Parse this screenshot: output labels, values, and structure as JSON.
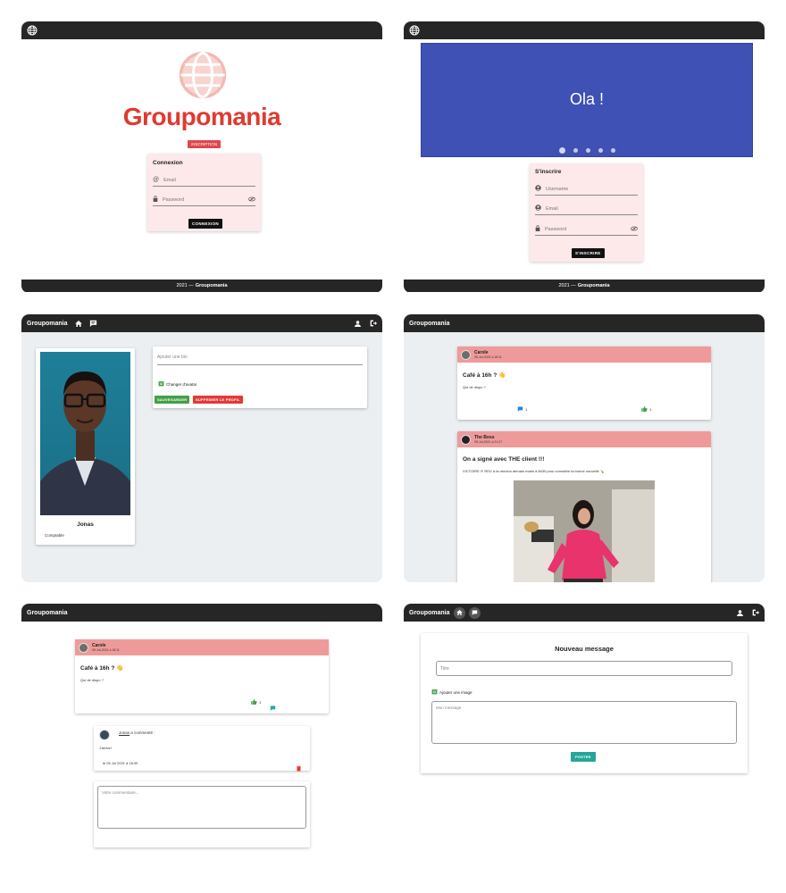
{
  "colors": {
    "bar": "#262626",
    "brand_red": "#e03a2f",
    "pink_light": "#fde9ea",
    "post_header": "#ef9a9a",
    "carousel_blue": "#3f51b5",
    "green": "#43a047",
    "red": "#e53935",
    "teal": "#26a69a"
  },
  "icons": [
    "globe-icon",
    "home-icon",
    "message-icon",
    "account-icon",
    "logout-icon",
    "at-icon",
    "lock-icon",
    "eye-off-icon",
    "user-icon",
    "comment-icon",
    "thumb-up-icon",
    "image-add-icon",
    "trash-icon"
  ],
  "panel1": {
    "brand": "Groupomania",
    "signup_tab": "INSCRIPTION",
    "login_title": "Connexion",
    "email_placeholder": "Email",
    "password_placeholder": "Password",
    "login_button": "CONNEXION",
    "footer_year": "2021 —",
    "footer_brand": "Groupomania"
  },
  "panel2": {
    "carousel_text": "Ola !",
    "carousel_slides": 5,
    "carousel_active_slide": 1,
    "signup_title": "S'inscrire",
    "username_placeholder": "Username",
    "email_placeholder": "Email",
    "password_placeholder": "Password",
    "signup_button": "S'INSCRIRE",
    "footer_year": "2021 —",
    "footer_brand": "Groupomania"
  },
  "panel3": {
    "brand": "Groupomania",
    "profile_name": "Jonas",
    "profile_role": "Comptable",
    "bio_placeholder": "Ajouter une bio",
    "change_avatar": "Changer d'avatar",
    "save_button": "SAUVEGARDER",
    "delete_button": "SUPPRIMER LE PROFIL"
  },
  "panel4": {
    "brand": "Groupomania",
    "posts": [
      {
        "author": "Carole",
        "date": "05-Jul-2021 à 18:11",
        "title": "Café à 16h ? 👋",
        "body": "Qui de dispo ?",
        "comments": "1",
        "likes": "1"
      },
      {
        "author": "The Boss",
        "date": "05-Jul-2021 à 21:07",
        "title": "On a signé avec THE client !!!",
        "body": "VICTOIRE !!! RDV à la réunion demain matin à 8h30 pour connaître la bonne nouvelle 🍾"
      }
    ]
  },
  "panel5": {
    "brand": "Groupomania",
    "post": {
      "author": "Carole",
      "date": "05-Jul-2021 à 18:11",
      "title": "Café à 16h ? 👋",
      "body": "Qui de dispo ?",
      "likes": "1"
    },
    "comment": {
      "author": "Jonas",
      "action": "a commenté :",
      "text": "J'arrive!",
      "date": "le 05 Jul 2021 à 18:39"
    },
    "comment_placeholder": "Votre commentaire..."
  },
  "panel6": {
    "brand": "Groupomania",
    "form_title": "Nouveau message",
    "title_placeholder": "Titre",
    "add_image": "Ajouter une image",
    "message_placeholder": "Mon message",
    "post_button": "POSTER"
  }
}
